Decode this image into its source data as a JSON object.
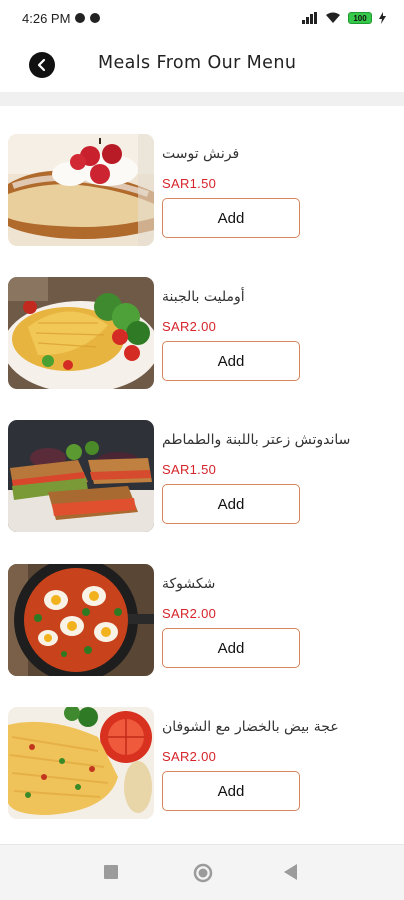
{
  "status_bar": {
    "time": "4:26 PM",
    "battery": "100",
    "icons": [
      "app-notification-icon",
      "app-notification-icon",
      "signal-icon",
      "wifi-icon",
      "battery-icon",
      "charging-icon"
    ]
  },
  "header": {
    "title": "Meals From Our Menu",
    "back_icon": "back-arrow-icon"
  },
  "meals": [
    {
      "name": "فرنش توست",
      "price": "SAR1.50",
      "add_label": "Add",
      "image": "french-toast-photo"
    },
    {
      "name": "أومليت بالجبنة",
      "price": "SAR2.00",
      "add_label": "Add",
      "image": "cheese-omelette-photo"
    },
    {
      "name": "ساندوتش زعتر باللبنة والطماطم",
      "price": "SAR1.50",
      "add_label": "Add",
      "image": "zaatar-sandwich-photo"
    },
    {
      "name": "شكشوكة",
      "price": "SAR2.00",
      "add_label": "Add",
      "image": "shakshuka-photo"
    },
    {
      "name": "عجة بيض بالخضار مع الشوفان",
      "price": "SAR2.00",
      "add_label": "Add",
      "image": "veggie-omelette-photo"
    }
  ],
  "nav": {
    "icons": [
      "recent-apps-icon",
      "home-icon",
      "back-icon"
    ]
  },
  "colors": {
    "price": "#d6242a",
    "button_border": "#d6865e",
    "background": "#f4f4f4"
  }
}
